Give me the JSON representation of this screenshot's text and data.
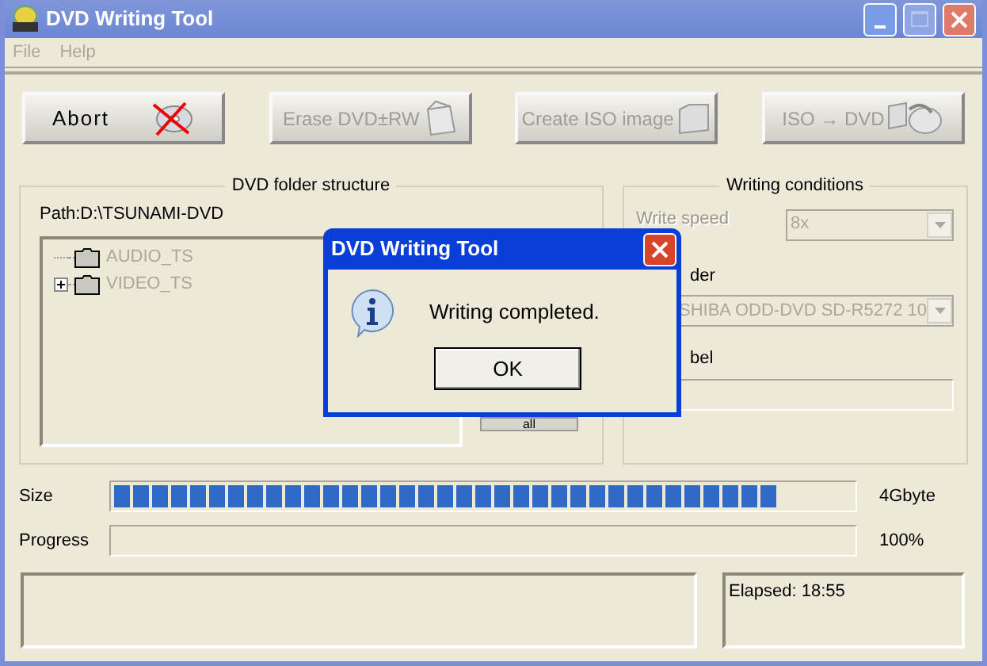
{
  "window": {
    "title": "DVD Writing Tool"
  },
  "menu": [
    "File",
    "Help"
  ],
  "toolbar": [
    {
      "label": "Abort",
      "kind": "abort",
      "disabled": false
    },
    {
      "label": "Erase DVD±RW",
      "kind": "erase",
      "disabled": true
    },
    {
      "label": "Create ISO image",
      "kind": "iso",
      "disabled": true
    },
    {
      "label": "ISO → DVD",
      "kind": "burn",
      "disabled": true
    }
  ],
  "folder_group": {
    "title": "DVD folder structure",
    "path": "Path:D:\\TSUNAMI-DVD",
    "tree": [
      {
        "label": "AUDIO_TS",
        "disabled": true,
        "has_children": false
      },
      {
        "label": "VIDEO_TS",
        "disabled": true,
        "has_children": true
      }
    ],
    "button": "all"
  },
  "conditions_group": {
    "title": "Writing conditions",
    "write_speed": {
      "label": "Write speed",
      "value": "8x",
      "disabled": true
    },
    "recorder": {
      "label": "der",
      "value": "SHIBA ODD-DVD SD-R5272 10",
      "disabled": true
    },
    "label": {
      "label": "bel"
    }
  },
  "size": {
    "label": "Size",
    "level": 0.9,
    "reading": "4Gbyte"
  },
  "progress": {
    "label": "Progress",
    "reading": "100%"
  },
  "status": {
    "elapsed": "Elapsed: 18:55"
  },
  "dialog": {
    "title": "DVD Writing Tool",
    "message": "Writing completed.",
    "button": "OK"
  }
}
